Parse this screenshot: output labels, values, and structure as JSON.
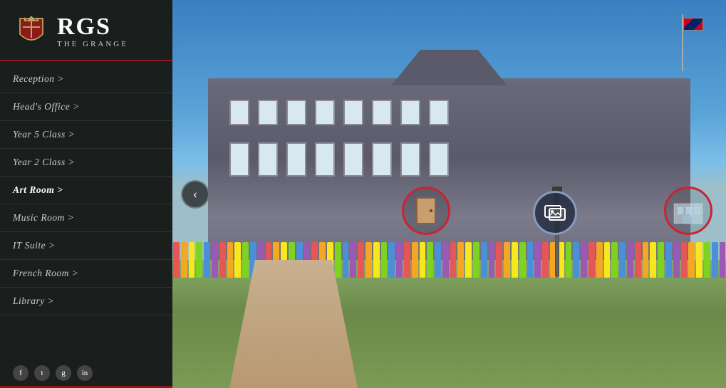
{
  "sidebar": {
    "logo": {
      "rgs_text": "RGS",
      "grange_text": "The Grange"
    },
    "nav_items": [
      {
        "id": "reception",
        "label": "Reception >",
        "active": false
      },
      {
        "id": "heads-office",
        "label": "Head's Office >",
        "active": false
      },
      {
        "id": "year5",
        "label": "Year 5 Class >",
        "active": false
      },
      {
        "id": "year2",
        "label": "Year 2 Class >",
        "active": false
      },
      {
        "id": "art-room",
        "label": "Art Room >",
        "active": true
      },
      {
        "id": "music-room",
        "label": "Music Room >",
        "active": false
      },
      {
        "id": "it-suite",
        "label": "IT Suite >",
        "active": false
      },
      {
        "id": "french-room",
        "label": "French Room >",
        "active": false
      },
      {
        "id": "library",
        "label": "Library >",
        "active": false
      }
    ],
    "social_icons": [
      "f",
      "t",
      "g+",
      "in"
    ]
  },
  "main": {
    "nav_arrow_left": "‹",
    "nav_arrow_right": "›",
    "hotspots": [
      {
        "id": "door-hotspot",
        "type": "door",
        "label": "Door"
      },
      {
        "id": "images-hotspot",
        "type": "images",
        "label": "Images"
      },
      {
        "id": "building-hotspot",
        "type": "building",
        "label": "Building"
      }
    ]
  },
  "fence_colors": [
    "#e85555",
    "#f5a623",
    "#f8e71c",
    "#7ed321",
    "#4a90d9",
    "#9b59b6",
    "#e85555",
    "#f5a623",
    "#f8e71c",
    "#7ed321",
    "#4a90d9",
    "#9b59b6",
    "#e85555",
    "#f5a623",
    "#f8e71c",
    "#7ed321",
    "#4a90d9",
    "#9b59b6",
    "#e85555",
    "#f5a623",
    "#f8e71c",
    "#7ed321",
    "#4a90d9",
    "#9b59b6",
    "#e85555",
    "#f5a623",
    "#f8e71c",
    "#7ed321",
    "#4a90d9",
    "#9b59b6",
    "#e85555",
    "#f5a623",
    "#f8e71c",
    "#7ed321",
    "#4a90d9",
    "#9b59b6",
    "#e85555",
    "#f5a623",
    "#f8e71c",
    "#7ed321",
    "#4a90d9",
    "#9b59b6",
    "#e85555",
    "#f5a623",
    "#f8e71c",
    "#7ed321",
    "#4a90d9",
    "#9b59b6",
    "#e85555",
    "#f5a623",
    "#f8e71c",
    "#7ed321",
    "#4a90d9",
    "#9b59b6",
    "#e85555",
    "#f5a623",
    "#f8e71c",
    "#7ed321",
    "#4a90d9",
    "#9b59b6",
    "#e85555",
    "#f5a623",
    "#f8e71c",
    "#7ed321",
    "#4a90d9",
    "#9b59b6",
    "#e85555",
    "#f5a623",
    "#f8e71c",
    "#7ed321",
    "#4a90d9",
    "#9b59b6"
  ]
}
